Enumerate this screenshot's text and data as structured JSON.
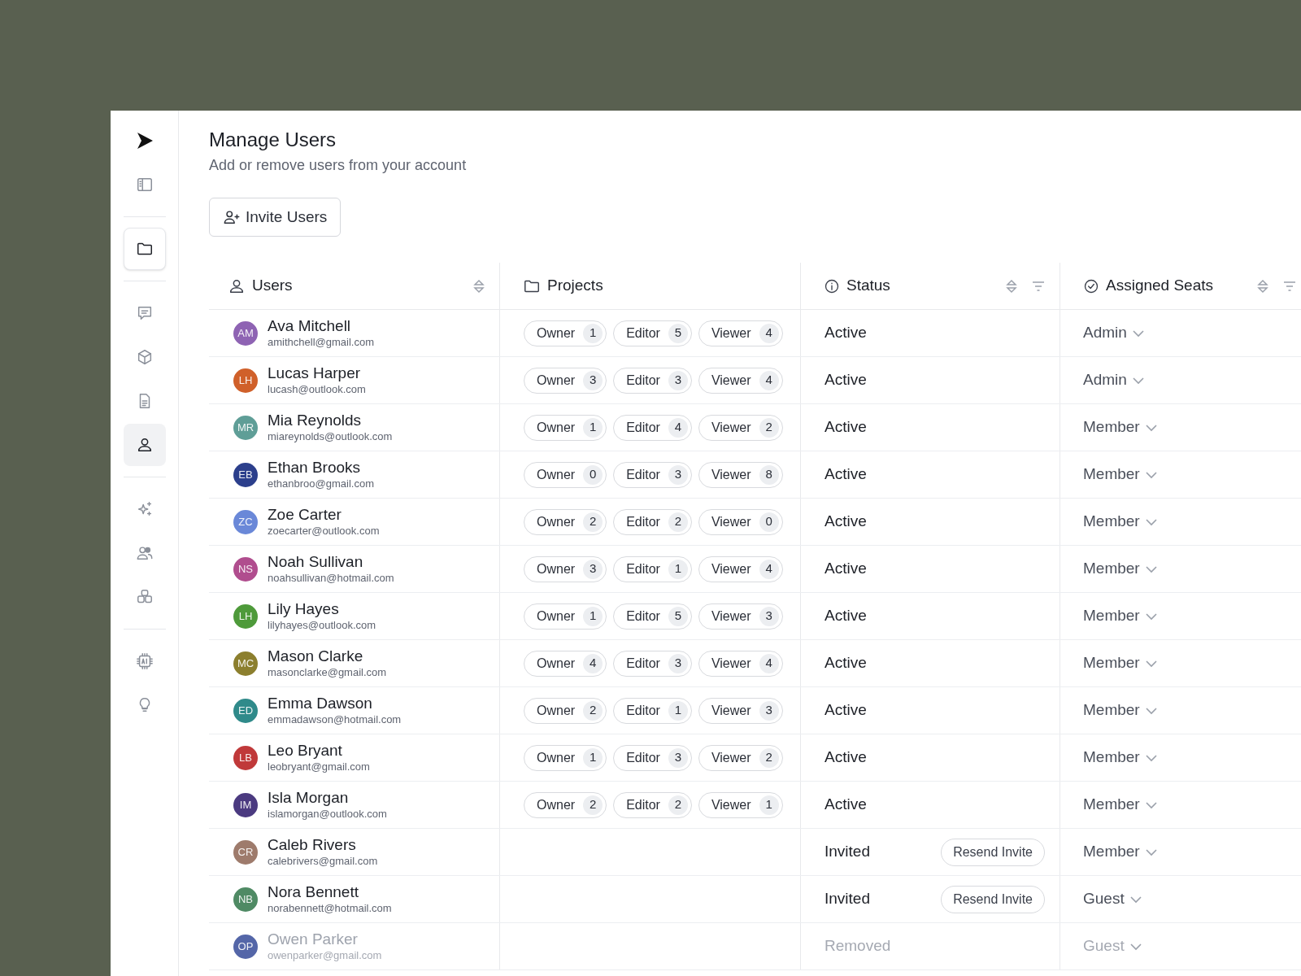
{
  "page": {
    "title": "Manage Users",
    "subtitle": "Add or remove users from your account",
    "invite_button": "Invite Users"
  },
  "sidebar": {
    "groups": [
      [
        {
          "selected": false,
          "boxed": false
        },
        {
          "selected": false,
          "boxed": false
        }
      ],
      [
        {
          "selected": false,
          "boxed": true
        }
      ],
      [
        {
          "selected": false,
          "boxed": false
        },
        {
          "selected": false,
          "boxed": false
        },
        {
          "selected": false,
          "boxed": false
        },
        {
          "selected": true,
          "boxed": false
        }
      ],
      [
        {
          "selected": false,
          "boxed": false
        },
        {
          "selected": false,
          "boxed": false
        },
        {
          "selected": false,
          "boxed": false
        }
      ],
      [
        {
          "selected": false,
          "boxed": false
        },
        {
          "selected": false,
          "boxed": false
        }
      ]
    ]
  },
  "table": {
    "columns": [
      {
        "label": "Users",
        "sortable": true,
        "filterable": false
      },
      {
        "label": "Projects",
        "sortable": false,
        "filterable": false
      },
      {
        "label": "Status",
        "sortable": true,
        "filterable": true
      },
      {
        "label": "Assigned Seats",
        "sortable": true,
        "filterable": true
      }
    ],
    "rows": [
      {
        "initials": "AM",
        "color": "#8e63b3",
        "name": "Ava Mitchell",
        "email": "amithchell@gmail.com",
        "roles": [
          {
            "label": "Owner",
            "count": "1"
          },
          {
            "label": "Editor",
            "count": "5"
          },
          {
            "label": "Viewer",
            "count": "4"
          }
        ],
        "status": "Active",
        "removed": false,
        "seat": "Admin"
      },
      {
        "initials": "LH",
        "color": "#d0602a",
        "name": "Lucas Harper",
        "email": "lucash@outlook.com",
        "roles": [
          {
            "label": "Owner",
            "count": "3"
          },
          {
            "label": "Editor",
            "count": "3"
          },
          {
            "label": "Viewer",
            "count": "4"
          }
        ],
        "status": "Active",
        "removed": false,
        "seat": "Admin"
      },
      {
        "initials": "MR",
        "color": "#5f9e97",
        "name": "Mia Reynolds",
        "email": "miareynolds@outlook.com",
        "roles": [
          {
            "label": "Owner",
            "count": "1"
          },
          {
            "label": "Editor",
            "count": "4"
          },
          {
            "label": "Viewer",
            "count": "2"
          }
        ],
        "status": "Active",
        "removed": false,
        "seat": "Member"
      },
      {
        "initials": "EB",
        "color": "#2c3f8c",
        "name": "Ethan Brooks",
        "email": "ethanbroo@gmail.com",
        "roles": [
          {
            "label": "Owner",
            "count": "0"
          },
          {
            "label": "Editor",
            "count": "3"
          },
          {
            "label": "Viewer",
            "count": "8"
          }
        ],
        "status": "Active",
        "removed": false,
        "seat": "Member"
      },
      {
        "initials": "ZC",
        "color": "#6a88d8",
        "name": "Zoe Carter",
        "email": "zoecarter@outlook.com",
        "roles": [
          {
            "label": "Owner",
            "count": "2"
          },
          {
            "label": "Editor",
            "count": "2"
          },
          {
            "label": "Viewer",
            "count": "0"
          }
        ],
        "status": "Active",
        "removed": false,
        "seat": "Member"
      },
      {
        "initials": "NS",
        "color": "#b04d8e",
        "name": "Noah Sullivan",
        "email": "noahsullivan@hotmail.com",
        "roles": [
          {
            "label": "Owner",
            "count": "3"
          },
          {
            "label": "Editor",
            "count": "1"
          },
          {
            "label": "Viewer",
            "count": "4"
          }
        ],
        "status": "Active",
        "removed": false,
        "seat": "Member"
      },
      {
        "initials": "LH",
        "color": "#4e9a3a",
        "name": "Lily Hayes",
        "email": "lilyhayes@outlook.com",
        "roles": [
          {
            "label": "Owner",
            "count": "1"
          },
          {
            "label": "Editor",
            "count": "5"
          },
          {
            "label": "Viewer",
            "count": "3"
          }
        ],
        "status": "Active",
        "removed": false,
        "seat": "Member"
      },
      {
        "initials": "MC",
        "color": "#8c7f2e",
        "name": "Mason Clarke",
        "email": "masonclarke@gmail.com",
        "roles": [
          {
            "label": "Owner",
            "count": "4"
          },
          {
            "label": "Editor",
            "count": "3"
          },
          {
            "label": "Viewer",
            "count": "4"
          }
        ],
        "status": "Active",
        "removed": false,
        "seat": "Member"
      },
      {
        "initials": "ED",
        "color": "#2f8a8a",
        "name": "Emma Dawson",
        "email": "emmadawson@hotmail.com",
        "roles": [
          {
            "label": "Owner",
            "count": "2"
          },
          {
            "label": "Editor",
            "count": "1"
          },
          {
            "label": "Viewer",
            "count": "3"
          }
        ],
        "status": "Active",
        "removed": false,
        "seat": "Member"
      },
      {
        "initials": "LB",
        "color": "#c0393a",
        "name": "Leo Bryant",
        "email": "leobryant@gmail.com",
        "roles": [
          {
            "label": "Owner",
            "count": "1"
          },
          {
            "label": "Editor",
            "count": "3"
          },
          {
            "label": "Viewer",
            "count": "2"
          }
        ],
        "status": "Active",
        "removed": false,
        "seat": "Member"
      },
      {
        "initials": "IM",
        "color": "#4b3a80",
        "name": "Isla Morgan",
        "email": "islamorgan@outlook.com",
        "roles": [
          {
            "label": "Owner",
            "count": "2"
          },
          {
            "label": "Editor",
            "count": "2"
          },
          {
            "label": "Viewer",
            "count": "1"
          }
        ],
        "status": "Active",
        "removed": false,
        "seat": "Member"
      },
      {
        "initials": "CR",
        "color": "#9e7b6c",
        "name": "Caleb Rivers",
        "email": "calebrivers@gmail.com",
        "roles": [],
        "status": "Invited",
        "removed": false,
        "action": "Resend Invite",
        "seat": "Member"
      },
      {
        "initials": "NB",
        "color": "#4f8a64",
        "name": "Nora Bennett",
        "email": "norabennett@hotmail.com",
        "roles": [],
        "status": "Invited",
        "removed": false,
        "action": "Resend Invite",
        "seat": "Guest"
      },
      {
        "initials": "OP",
        "color": "#5466a8",
        "name": "Owen Parker",
        "email": "owenparker@gmail.com",
        "roles": [],
        "status": "Removed",
        "removed": true,
        "seat": "Guest"
      }
    ]
  }
}
